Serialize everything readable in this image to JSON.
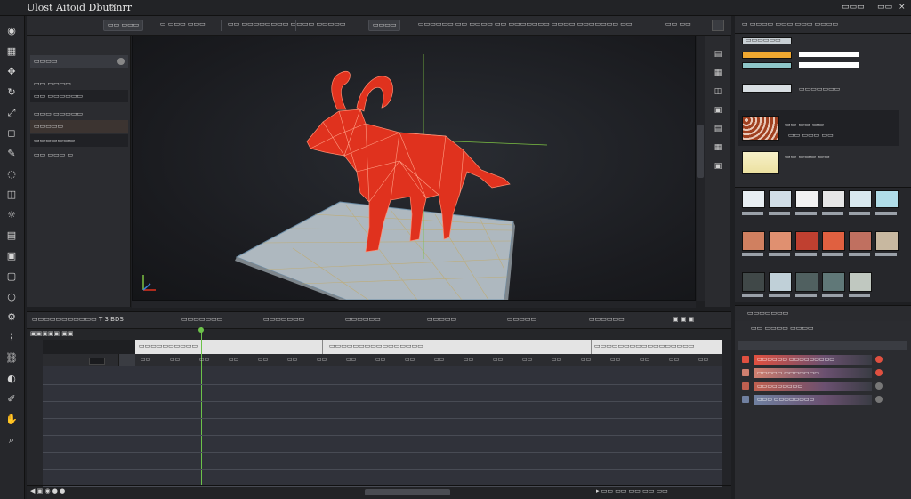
{
  "window": {
    "title": "Ulost Aitoid Dbutinrr",
    "close_glyph": "×",
    "controls": [
      "▭▭▭",
      "▭▭",
      "×"
    ]
  },
  "tools": [
    "record-icon",
    "grid-icon",
    "move-icon",
    "rotate-icon",
    "scale-icon",
    "select-icon",
    "pen-icon",
    "lasso-icon",
    "camera-icon",
    "light-icon",
    "paint-icon",
    "layers-icon",
    "box-icon",
    "sphere-icon",
    "gear-icon",
    "bone-icon",
    "link-icon",
    "eye-icon",
    "brush-icon",
    "hand-icon",
    "zoom-icon"
  ],
  "viewport_header": {
    "button1": "▭▭ ▭▭▭",
    "items": [
      "▭ ▭▭▭ ▭▭▭",
      "▭▭ ▭▭▭▭▭▭▭▭ ▭▭",
      "▭▭ ▭▭▭▭▭",
      "▭▭▭▭",
      "▭▭▭▭▭▭ ▭▭ ▭▭▭▭ ▭▭ ▭▭▭▭▭▭▭ ▭▭▭▭ ▭▭▭▭▭▭▭ ▭▭"
    ],
    "right_label": "▭▭ ▭▭"
  },
  "outliner": {
    "header": "▭▭▭▭",
    "rows": [
      "▭▭  ▭▭▭▭",
      "▭▭ ▭▭▭▭▭▭",
      "▭▭▭ ▭▭▭▭▭",
      "▭▭▭▭▭",
      "▭▭▭▭▭▭▭",
      "▭▭ ▭▭▭ ▭"
    ]
  },
  "timeline": {
    "header_left": "▭▭▭▭▭▭▭▭▭▭▭ T 3 BDS",
    "header_items": [
      "▭▭▭▭▭▭▭",
      "▭▭▭▭▭▭▭",
      "▭▭▭▭▭▭",
      "▭▭▭▭▭",
      "▭▭▭▭▭",
      "▭▭▭▭▭▭"
    ],
    "ruler_marks": [
      "▭▭▭▭▭▭▭▭▭▭",
      "▭▭▭▭▭▭▭▭▭▭▭▭▭▭▭▭",
      "▭▭▭▭▭▭▭▭▭▭▭▭▭▭▭▭▭"
    ],
    "ticks": [
      "▭▭",
      "▭▭",
      "▭▭",
      "▭▭",
      "▭▭",
      "▭▭",
      "▭▭",
      "▭▭",
      "▭▭",
      "▭▭",
      "▭▭",
      "▭▭",
      "▭▭",
      "▭▭",
      "▭▭",
      "▭▭",
      "▭▭",
      "▭▭",
      "▭▭",
      "▭▭"
    ],
    "playhead_fraction": 0.11
  },
  "right_panel": {
    "header": "▭ ▭▭▭▭  ▭▭▭ ▭▭▭  ▭▭▭▭",
    "attr_rows": [
      "▭▭▭▭▭▭",
      "▭▭▭▭▭▭▭",
      "▭▭ ▭▭ ▭▭",
      "▭▭ ▭▭▭ ▭▭",
      "▭▭ ▭▭▭ ▭▭"
    ],
    "layers_header": "▭▭▭▭▭▭▭",
    "layers_sub": "▭▭ ▭▭▭▭ ▭▭▭▭",
    "layer_rows": [
      "▭▭▭▭▭▭ ▭▭▭▭▭▭▭▭▭",
      "▭▭▭▭▭ ▭▭▭▭▭▭▭",
      "▭▭▭▭▭▭▭▭▭",
      "▭▭▭ ▭▭▭▭▭▭▭▭"
    ]
  },
  "colors": {
    "model": "#e0321e",
    "model_wire": "#ff8c70",
    "grid_plane": "#c9d2d8",
    "playhead": "#6cc24a",
    "axis_green": "#7cc043"
  }
}
